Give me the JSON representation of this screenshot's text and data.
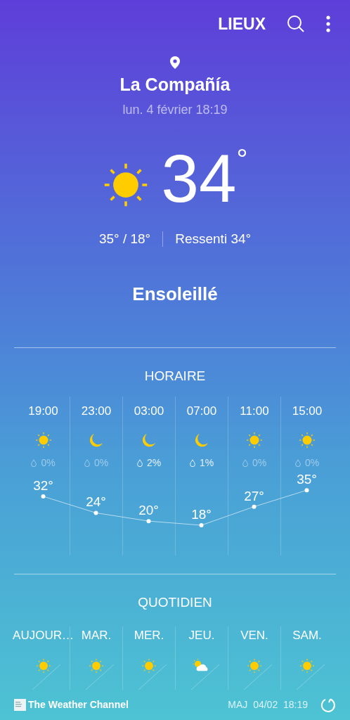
{
  "toolbar": {
    "places_label": "LIEUX"
  },
  "location": {
    "name": "La Compañía",
    "datetime": "lun. 4 février 18:19"
  },
  "current": {
    "kind": "sun",
    "temperature": "34",
    "degree": "°",
    "high_low": "35° / 18°",
    "feels_like": "Ressenti 34°",
    "condition": "Ensoleillé"
  },
  "hourly": {
    "title": "HORAIRE",
    "hours": [
      {
        "time": "19:00",
        "kind": "sun",
        "precip": "0%",
        "dimmed": true,
        "temp": "32°"
      },
      {
        "time": "23:00",
        "kind": "moon",
        "precip": "0%",
        "dimmed": true,
        "temp": "24°"
      },
      {
        "time": "03:00",
        "kind": "moon",
        "precip": "2%",
        "dimmed": false,
        "temp": "20°"
      },
      {
        "time": "07:00",
        "kind": "moon",
        "precip": "1%",
        "dimmed": false,
        "temp": "18°"
      },
      {
        "time": "11:00",
        "kind": "sun",
        "precip": "0%",
        "dimmed": true,
        "temp": "27°"
      },
      {
        "time": "15:00",
        "kind": "sun",
        "precip": "0%",
        "dimmed": true,
        "temp": "35°"
      }
    ]
  },
  "daily": {
    "title": "QUOTIDIEN",
    "days": [
      {
        "day": "AUJOUR…",
        "kind": "sun"
      },
      {
        "day": "MAR.",
        "kind": "sun"
      },
      {
        "day": "MER.",
        "kind": "sun"
      },
      {
        "day": "JEU.",
        "kind": "sun-cloud"
      },
      {
        "day": "VEN.",
        "kind": "sun"
      },
      {
        "day": "SAM.",
        "kind": "sun"
      }
    ]
  },
  "footer": {
    "brand": "The Weather Channel",
    "updated": "MAJ  04/02  18:19"
  }
}
